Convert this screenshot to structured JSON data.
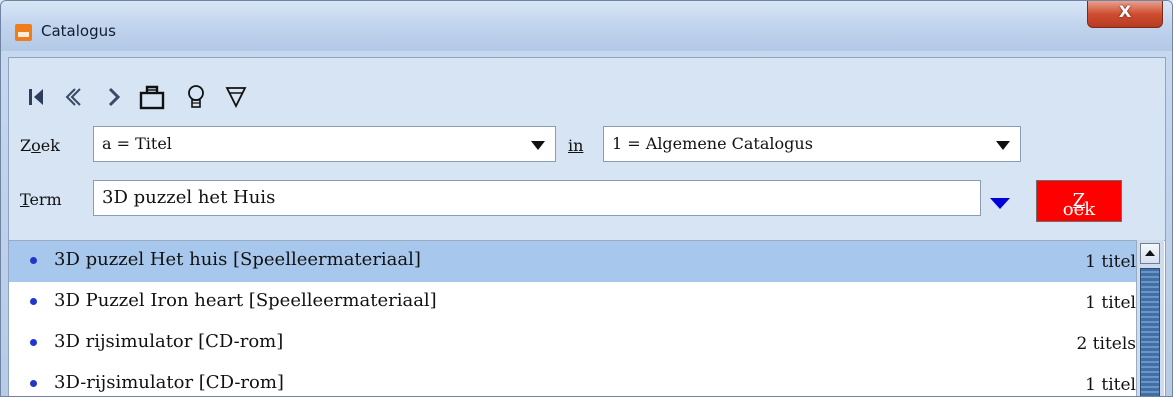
{
  "window": {
    "title": "Catalogus",
    "close_label": "X"
  },
  "toolbar": {
    "icons": [
      "first-icon",
      "previous-icon",
      "next-icon",
      "basket-icon",
      "lightbulb-icon",
      "filter-icon"
    ]
  },
  "search": {
    "zoek_label_prefix": "Z",
    "zoek_label_underlined": "o",
    "zoek_label_suffix": "ek",
    "zoek_value": "a = Titel",
    "in_label": "in",
    "in_value": "1 = Algemene Catalogus",
    "term_label_underlined": "T",
    "term_label_suffix": "erm",
    "term_value": "3D puzzel het Huis",
    "button_underlined": "Z",
    "button_suffix": "oek"
  },
  "results": [
    {
      "title": "3D puzzel Het huis [Speelleermateriaal]",
      "count": "1 titel",
      "selected": true
    },
    {
      "title": "3D Puzzel Iron heart [Speelleermateriaal]",
      "count": "1 titel",
      "selected": false
    },
    {
      "title": "3D rijsimulator [CD-rom]",
      "count": "2 titels",
      "selected": false
    },
    {
      "title": "3D-rijsimulator [CD-rom]",
      "count": "1 titel",
      "selected": false
    }
  ],
  "colors": {
    "accent": "#ff0000",
    "selection": "#a7c8ec",
    "bullet": "#2037c9"
  }
}
